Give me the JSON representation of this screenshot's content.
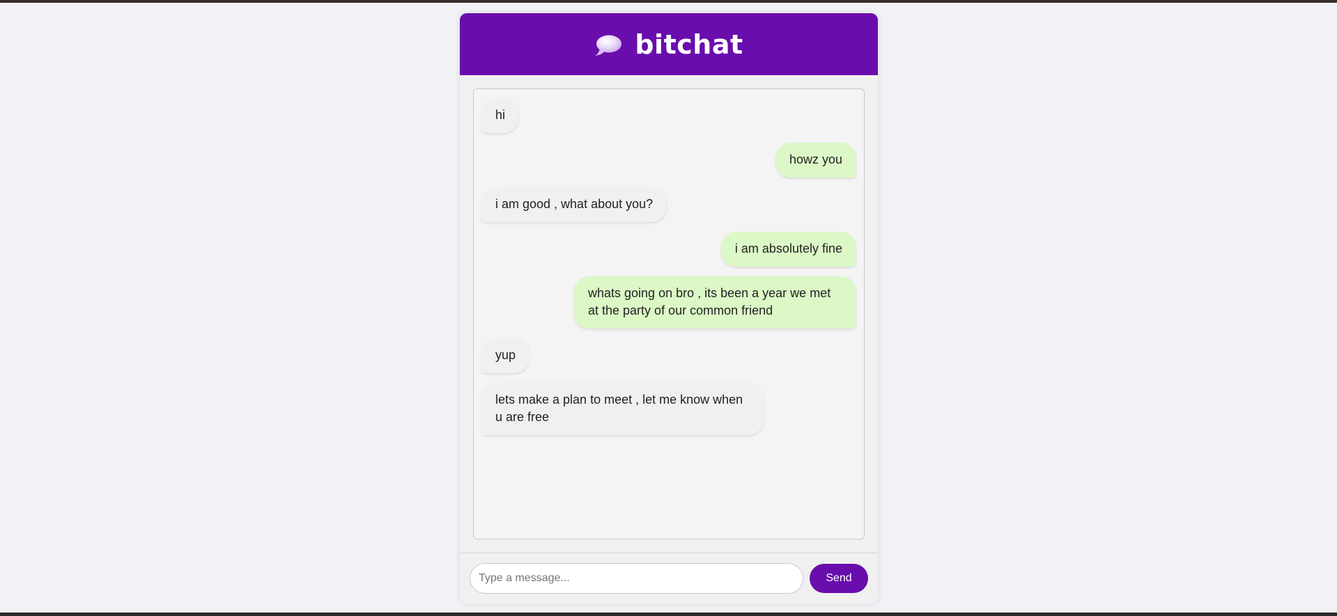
{
  "app": {
    "title": "bitchat",
    "logo_icon": "speech-bubble-icon",
    "brand_color": "#6a0dad"
  },
  "messages": [
    {
      "type": "received",
      "text": "hi"
    },
    {
      "type": "sent",
      "text": "howz you"
    },
    {
      "type": "received",
      "text": "i am good , what about you?"
    },
    {
      "type": "sent",
      "text": "i am absolutely fine"
    },
    {
      "type": "sent",
      "text": "whats going on bro , its been a year we met at the party of our common friend"
    },
    {
      "type": "received",
      "text": "yup"
    },
    {
      "type": "received",
      "text": "lets make a plan to meet , let me know when u are free"
    }
  ],
  "composer": {
    "placeholder": "Type a message...",
    "value": "",
    "send_label": "Send"
  },
  "colors": {
    "sent_bubble": "#dcf8c6",
    "received_bubble": "#f0f0f0",
    "page_background": "#f0f2f5"
  }
}
